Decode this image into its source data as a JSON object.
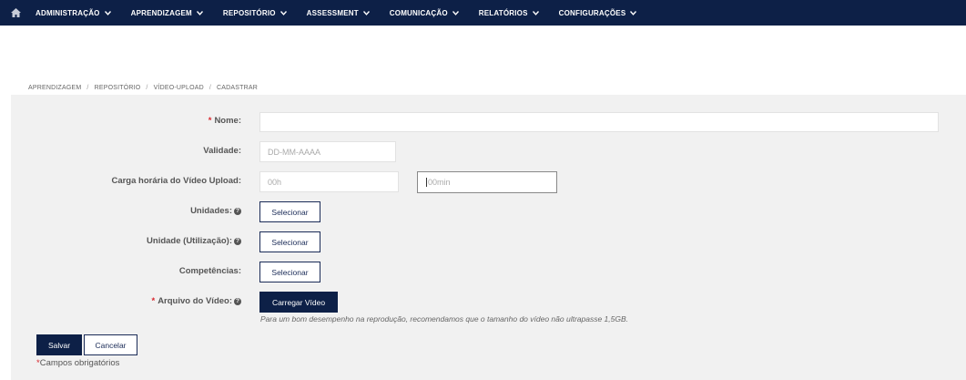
{
  "nav": {
    "items": [
      {
        "label": "ADMINISTRAÇÃO"
      },
      {
        "label": "APRENDIZAGEM"
      },
      {
        "label": "REPOSITÓRIO"
      },
      {
        "label": "ASSESSMENT"
      },
      {
        "label": "COMUNICAÇÃO"
      },
      {
        "label": "RELATÓRIOS"
      },
      {
        "label": "CONFIGURAÇÕES"
      }
    ],
    "home_icon": "home-icon",
    "chevron_icon": "chevron-down-icon"
  },
  "breadcrumb": {
    "items": [
      "APRENDIZAGEM",
      "REPOSITÓRIO",
      "VÍDEO-UPLOAD",
      "CADASTRAR"
    ],
    "separator": "/"
  },
  "form": {
    "nome": {
      "label": "Nome:",
      "required": "*",
      "value": ""
    },
    "validade": {
      "label": "Validade:",
      "placeholder": "DD-MM-AAAA"
    },
    "carga": {
      "label": "Carga horária do Vídeo Upload:",
      "hours_placeholder": "00h",
      "minutes_placeholder": "00min"
    },
    "unidades": {
      "label": "Unidades:",
      "button": "Selecionar"
    },
    "unidade_utilizacao": {
      "label": "Unidade (Utilização):",
      "button": "Selecionar"
    },
    "competencias": {
      "label": "Competências:",
      "button": "Selecionar"
    },
    "arquivo": {
      "label": "Arquivo do Vídeo:",
      "required": "*",
      "button": "Carregar Vídeo",
      "hint": "Para um bom desempenho na reprodução, recomendamos que o tamanho do vídeo não ultrapasse 1,5GB."
    },
    "help_symbol": "?"
  },
  "actions": {
    "save": "Salvar",
    "cancel": "Cancelar"
  },
  "footer": {
    "required_star": "*",
    "required_note": "Campos obrigatórios"
  },
  "colors": {
    "navbar": "#0d2047",
    "required": "#d9282f",
    "panel": "#f1f1f1"
  }
}
